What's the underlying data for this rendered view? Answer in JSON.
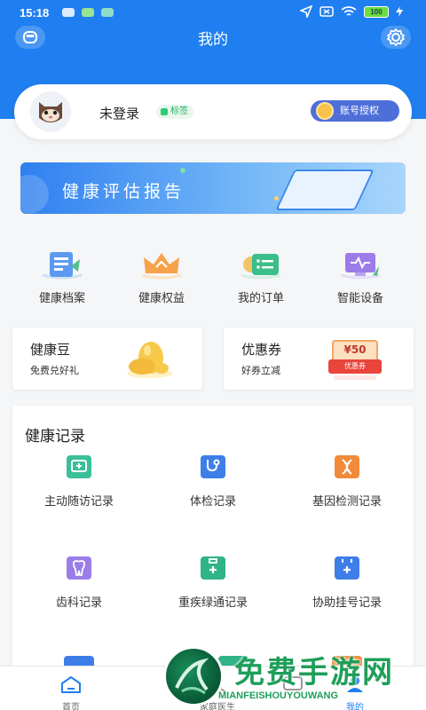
{
  "status_bar": {
    "time": "15:18",
    "battery": "100"
  },
  "header": {
    "title": "我的"
  },
  "profile": {
    "login_text": "未登录",
    "tag": "标签",
    "auth_button": "账号授权"
  },
  "banner": {
    "text": "健康评估报告"
  },
  "menu": [
    {
      "label": "健康档案",
      "icon": "health-file-icon"
    },
    {
      "label": "健康权益",
      "icon": "crown-icon"
    },
    {
      "label": "我的订单",
      "icon": "order-list-icon"
    },
    {
      "label": "智能设备",
      "icon": "smart-device-icon"
    }
  ],
  "cards": [
    {
      "title": "健康豆",
      "subtitle": "免费兑好礼",
      "icon": "bean-icon"
    },
    {
      "title": "优惠券",
      "subtitle": "好券立减",
      "coupon_value": "¥50",
      "coupon_label": "优惠券",
      "icon": "coupon-icon"
    }
  ],
  "records": {
    "title": "健康记录",
    "items": [
      {
        "label": "主动随访记录",
        "color": "#3bbf9a",
        "icon": "followup-icon"
      },
      {
        "label": "体检记录",
        "color": "#3d7ee8",
        "icon": "stethoscope-icon"
      },
      {
        "label": "基因检测记录",
        "color": "#f28a3c",
        "icon": "dna-icon"
      },
      {
        "label": "齿科记录",
        "color": "#9b7ce8",
        "icon": "tooth-icon"
      },
      {
        "label": "重疾绿通记录",
        "color": "#2fb388",
        "icon": "medkit-icon"
      },
      {
        "label": "协助挂号记录",
        "color": "#3d7ee8",
        "icon": "calendar-plus-icon"
      }
    ]
  },
  "tabbar": [
    {
      "label": "首页",
      "icon": "home-icon"
    },
    {
      "label": "家庭医生",
      "icon": "doctor-icon"
    },
    {
      "label": "",
      "icon": "message-icon"
    },
    {
      "label": "我的",
      "icon": "user-icon"
    }
  ],
  "watermark": {
    "title": "免费手游网",
    "subtitle": "MIANFEISHOUYOUWANG"
  },
  "colors": {
    "primary": "#1f7ff0",
    "tag_green": "#27ae60",
    "auth_button": "#4f6fd8"
  }
}
